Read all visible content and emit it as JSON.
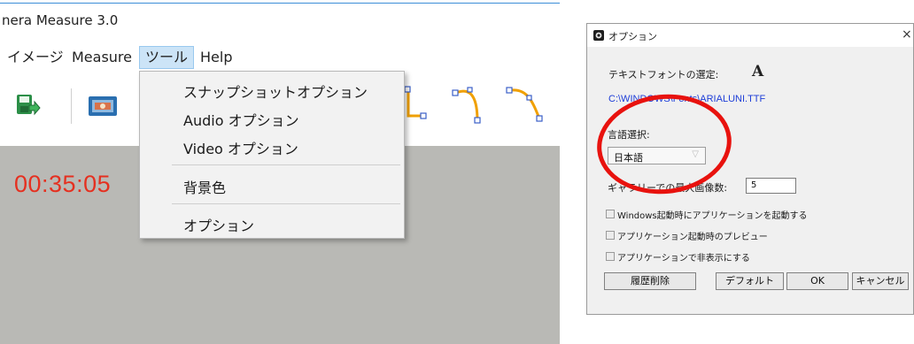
{
  "app": {
    "title": "nera Measure 3.0",
    "menu": [
      "イメージ",
      "Measure",
      "ツール",
      "Help"
    ],
    "active_menu": "ツール",
    "timer": "00:35:05",
    "tools_menu": {
      "items": [
        "スナップショットオプション",
        "Audio オプション",
        "Video オプション",
        "背景色",
        "オプション"
      ]
    },
    "toolbar_icons": [
      "save-icon",
      "snapshot-icon",
      "angle-tool-icon",
      "arc-tool-icon",
      "curve-tool-icon"
    ]
  },
  "dialog": {
    "title": "オプション",
    "close_glyph": "×",
    "text_font_label": "テキストフォントの選定:",
    "font_sample": "A",
    "font_path": "C:\\WINDOWS\\Fonts\\ARIALUNI.TTF",
    "language_label": "言語選択:",
    "language_value": "日本語",
    "gallery_label": "ギャラリーでの最大画像数:",
    "gallery_value": "5",
    "checkboxes": [
      {
        "label": "Windows起動時にアプリケーションを起動する",
        "checked": false
      },
      {
        "label": "アプリケーション起動時のプレビュー",
        "checked": false
      },
      {
        "label": "アプリケーションで非表示にする",
        "checked": false
      }
    ],
    "buttons": {
      "clear_history": "履歴削除",
      "default": "デフォルト",
      "ok": "OK",
      "cancel": "キャンセル"
    },
    "highlight_color": "#e8120e"
  }
}
